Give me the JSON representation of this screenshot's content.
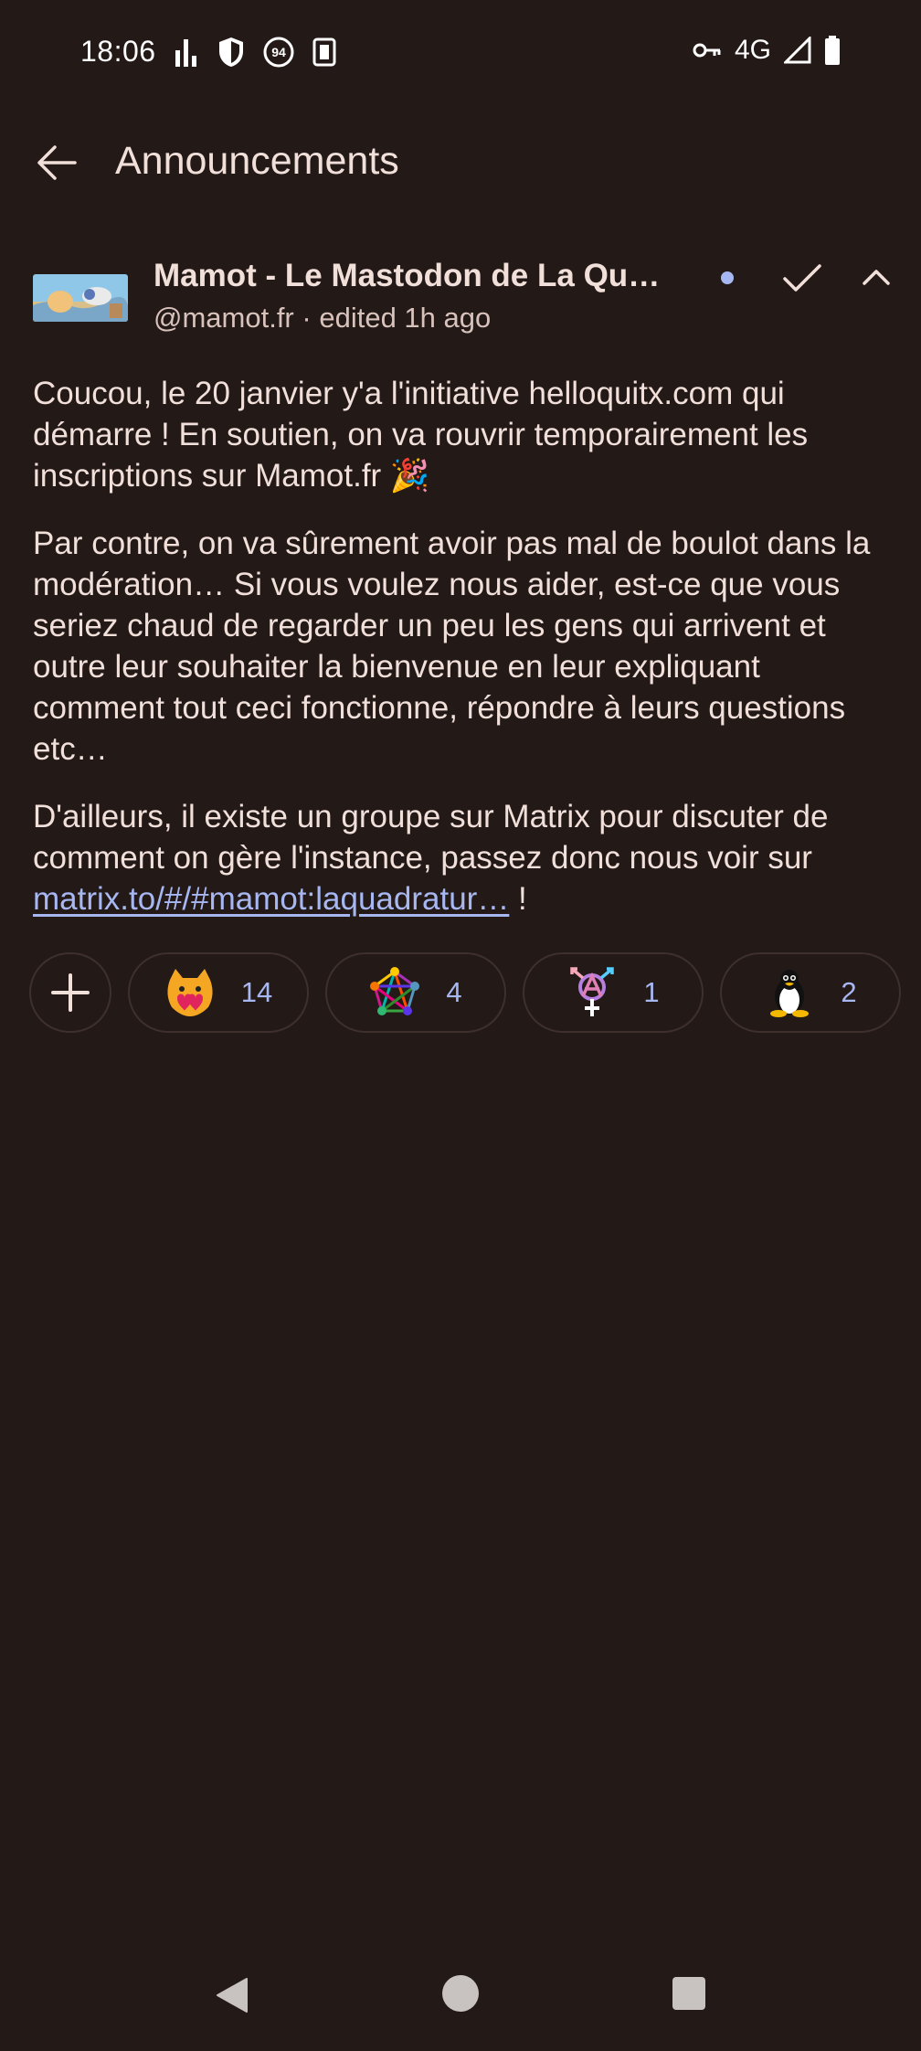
{
  "status_bar": {
    "time": "18:06",
    "icons_left": [
      "signal-bars-icon",
      "shield-icon",
      "badge-94-icon",
      "sim-card-icon"
    ],
    "badge_number": "94",
    "network_label": "4G",
    "icons_right": [
      "vpn-key-icon",
      "cell-signal-icon",
      "battery-icon"
    ]
  },
  "app_bar": {
    "back_icon": "arrow-back-icon",
    "title": "Announcements"
  },
  "announcement": {
    "author_name": "Mamot - Le Mastodon de La Quad…",
    "handle": "@mamot.fr",
    "separator": "·",
    "edited": "edited 1h ago",
    "unread_color": "#a7b7f2",
    "paragraphs": [
      "Coucou, le 20 janvier y'a l'initiative helloquitx.com qui démarre ! En soutien, on va rouvrir temporairement les inscriptions sur Mamot.fr 🎉",
      "Par contre, on va sûrement avoir pas mal de boulot dans la modération… Si vous voulez nous aider, est-ce que vous seriez chaud de regarder un peu les gens qui arrivent et outre leur souhaiter la bienvenue en leur expliquant comment tout ceci fonctionne, répondre à leurs questions etc…",
      "D'ailleurs, il existe un groupe sur Matrix pour discuter de comment on gère l'instance, passez donc nous voir sur"
    ],
    "link_text": "matrix.to/#/#mamot:laquadratur…",
    "link_suffix": " !"
  },
  "reactions": {
    "add_icon": "plus-icon",
    "items": [
      {
        "emoji": "blobcat-heart-emoji",
        "count": "14"
      },
      {
        "emoji": "fediverse-pentagram-emoji",
        "count": "4"
      },
      {
        "emoji": "trans-anarchy-symbol-emoji",
        "count": "1"
      },
      {
        "emoji": "tux-penguin-emoji",
        "count": "2"
      }
    ]
  },
  "colors": {
    "background": "#231917",
    "text": "#f1dfda",
    "secondary_text": "#d8c2bc",
    "accent": "#a7b7f2"
  }
}
